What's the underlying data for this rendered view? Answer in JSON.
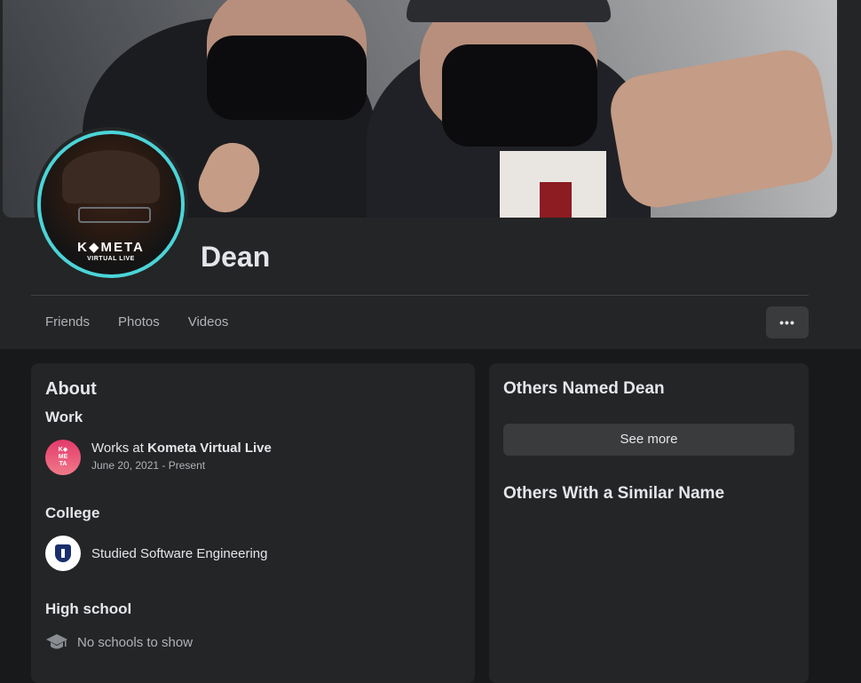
{
  "profile": {
    "name": "Dean",
    "avatar_logo": "K◆META",
    "avatar_logo_sub": "VIRTUAL LIVE"
  },
  "tabs": [
    {
      "label": "Friends"
    },
    {
      "label": "Photos"
    },
    {
      "label": "Videos"
    }
  ],
  "more_button": {
    "label": "•••"
  },
  "about": {
    "title": "About",
    "work": {
      "heading": "Work",
      "prefix": "Works at ",
      "company": "Kometa Virtual Live",
      "dates": "June 20, 2021 - Present",
      "icon": "kometa-logo-icon",
      "icon_text": [
        "K◆",
        "ME",
        "TA"
      ]
    },
    "college": {
      "heading": "College",
      "text": "Studied Software Engineering",
      "icon": "college-shield-icon"
    },
    "high_school": {
      "heading": "High school",
      "text": "No schools to show",
      "icon": "graduation-cap-icon"
    }
  },
  "sidebar": {
    "others_named_title": "Others Named Dean",
    "see_more_label": "See more",
    "similar_title": "Others With a Similar Name"
  },
  "colors": {
    "background": "#18191a",
    "card": "#242526",
    "button": "#3a3b3c",
    "text": "#e4e6eb",
    "muted": "#b0b3b8",
    "avatar_ring": "#4bd4d8"
  }
}
